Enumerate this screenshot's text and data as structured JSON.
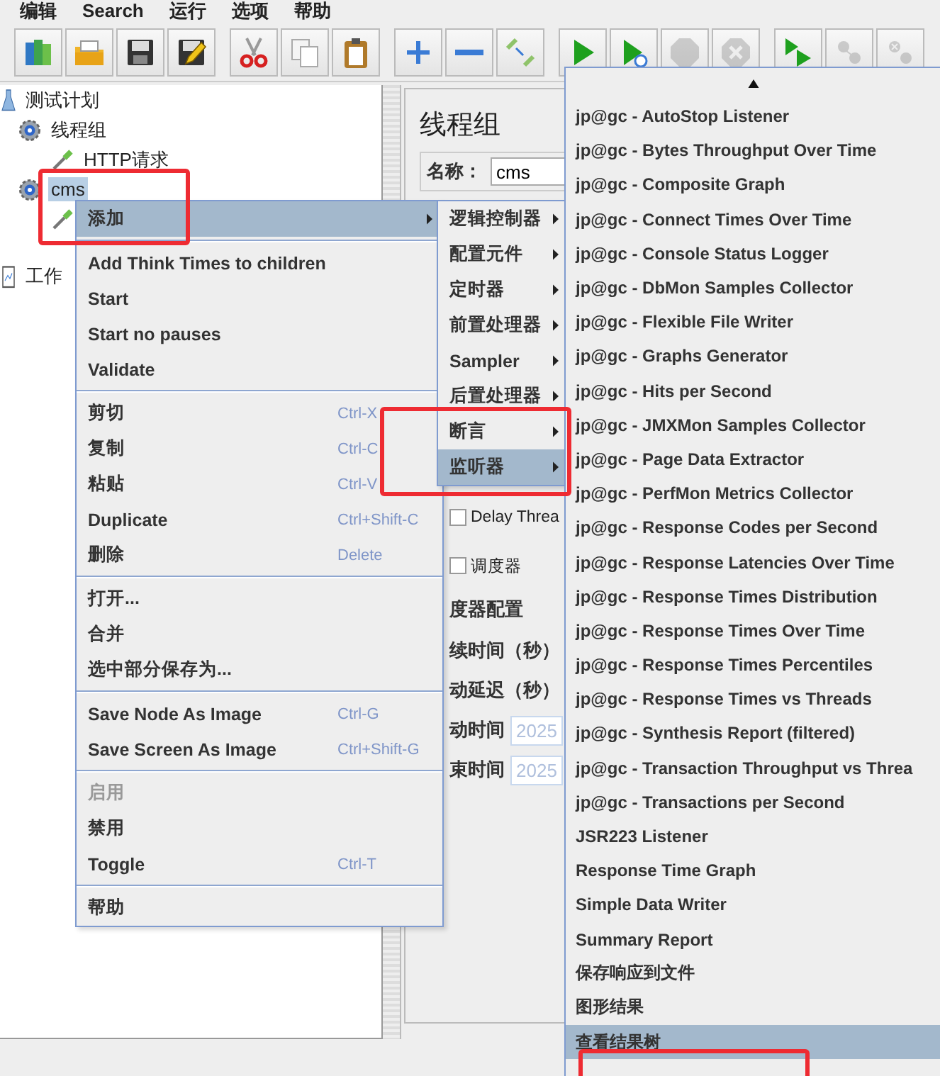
{
  "menubar": [
    "编辑",
    "Search",
    "运行",
    "选项",
    "帮助"
  ],
  "toolbar": [
    {
      "buttons": [
        {
          "kind": "templates",
          "disabled": false
        },
        {
          "kind": "open",
          "disabled": false
        },
        {
          "kind": "save",
          "disabled": false
        },
        {
          "kind": "save-as",
          "disabled": false
        }
      ]
    },
    {
      "buttons": [
        {
          "kind": "cut",
          "disabled": false
        },
        {
          "kind": "copy",
          "disabled": false
        },
        {
          "kind": "paste",
          "disabled": false
        }
      ]
    },
    {
      "buttons": [
        {
          "kind": "expand",
          "disabled": false
        },
        {
          "kind": "collapse",
          "disabled": false
        },
        {
          "kind": "toggle",
          "disabled": false
        }
      ]
    },
    {
      "buttons": [
        {
          "kind": "start",
          "disabled": false
        },
        {
          "kind": "start-no-pause",
          "disabled": false
        },
        {
          "kind": "stop",
          "disabled": true
        },
        {
          "kind": "shutdown",
          "disabled": true
        }
      ]
    },
    {
      "buttons": [
        {
          "kind": "remote-start",
          "disabled": false
        },
        {
          "kind": "remote-stop",
          "disabled": true
        },
        {
          "kind": "remote-shutdown",
          "disabled": true
        }
      ]
    }
  ],
  "tree": [
    {
      "kind": "plan",
      "label": "测试计划",
      "selected": false,
      "children": [
        {
          "kind": "thread-group",
          "label": "线程组",
          "selected": false,
          "children": [
            {
              "kind": "sampler",
              "label": "HTTP请求",
              "selected": false
            }
          ]
        },
        {
          "kind": "thread-group",
          "label": "cms",
          "selected": true,
          "children": [
            {
              "kind": "sampler",
              "selected": false
            }
          ]
        }
      ]
    },
    {
      "kind": "workbench",
      "label": "工作",
      "selected": false
    }
  ],
  "panel": {
    "title": "线程组",
    "name_label": "名称：",
    "name_value": "cms",
    "delay_checkbox": {
      "label": "Delay Threa",
      "checked": false
    },
    "scheduler_checkbox": {
      "label": "调度器",
      "checked": false
    },
    "scheduler_config": {
      "title": "度器配置",
      "fields": [
        {
          "label": "续时间（秒）"
        },
        {
          "label": "动延迟（秒）"
        },
        {
          "label": "动时间",
          "value": "2025"
        },
        {
          "label": "束时间",
          "value": "2025"
        }
      ]
    }
  },
  "context_menu": {
    "groups": [
      {
        "items": [
          {
            "label": "添加",
            "submenu": true,
            "selected": true,
            "disabled": false
          }
        ]
      },
      {
        "items": [
          {
            "label": "Add Think Times to children",
            "submenu": false,
            "selected": false,
            "disabled": false
          },
          {
            "label": "Start",
            "submenu": false,
            "selected": false,
            "disabled": false
          },
          {
            "label": "Start no pauses",
            "submenu": false,
            "selected": false,
            "disabled": false
          },
          {
            "label": "Validate",
            "submenu": false,
            "selected": false,
            "disabled": false
          }
        ]
      },
      {
        "items": [
          {
            "label": "剪切",
            "shortcut": "Ctrl-X",
            "submenu": false,
            "selected": false,
            "disabled": false
          },
          {
            "label": "复制",
            "shortcut": "Ctrl-C",
            "submenu": false,
            "selected": false,
            "disabled": false
          },
          {
            "label": "粘贴",
            "shortcut": "Ctrl-V",
            "submenu": false,
            "selected": false,
            "disabled": false
          },
          {
            "label": "Duplicate",
            "shortcut": "Ctrl+Shift-C",
            "submenu": false,
            "selected": false,
            "disabled": false
          },
          {
            "label": "删除",
            "shortcut": "Delete",
            "submenu": false,
            "selected": false,
            "disabled": false
          }
        ]
      },
      {
        "items": [
          {
            "label": "打开...",
            "submenu": false,
            "selected": false,
            "disabled": false
          },
          {
            "label": "合并",
            "submenu": false,
            "selected": false,
            "disabled": false
          },
          {
            "label": "选中部分保存为...",
            "submenu": false,
            "selected": false,
            "disabled": false
          }
        ]
      },
      {
        "items": [
          {
            "label": "Save Node As Image",
            "shortcut": "Ctrl-G",
            "submenu": false,
            "selected": false,
            "disabled": false
          },
          {
            "label": "Save Screen As Image",
            "shortcut": "Ctrl+Shift-G",
            "submenu": false,
            "selected": false,
            "disabled": false
          }
        ]
      },
      {
        "items": [
          {
            "label": "启用",
            "submenu": false,
            "selected": false,
            "disabled": true
          },
          {
            "label": "禁用",
            "submenu": false,
            "selected": false,
            "disabled": false
          },
          {
            "label": "Toggle",
            "shortcut": "Ctrl-T",
            "submenu": false,
            "selected": false,
            "disabled": false
          }
        ]
      },
      {
        "items": [
          {
            "label": "帮助",
            "submenu": false,
            "selected": false,
            "disabled": false
          }
        ]
      }
    ]
  },
  "category_menu": {
    "items": [
      {
        "label": "逻辑控制器",
        "selected": false
      },
      {
        "label": "配置元件",
        "selected": false
      },
      {
        "label": "定时器",
        "selected": false
      },
      {
        "label": "前置处理器",
        "selected": false
      },
      {
        "label": "Sampler",
        "selected": false
      },
      {
        "label": "后置处理器",
        "selected": false
      },
      {
        "label": "断言",
        "selected": false
      },
      {
        "label": "监听器",
        "selected": true
      }
    ]
  },
  "listener_menu": {
    "items": [
      {
        "label": "jp@gc - AutoStop Listener",
        "selected": false
      },
      {
        "label": "jp@gc - Bytes Throughput Over Time",
        "selected": false
      },
      {
        "label": "jp@gc - Composite Graph",
        "selected": false
      },
      {
        "label": "jp@gc - Connect Times Over Time",
        "selected": false
      },
      {
        "label": "jp@gc - Console Status Logger",
        "selected": false
      },
      {
        "label": "jp@gc - DbMon Samples Collector",
        "selected": false
      },
      {
        "label": "jp@gc - Flexible File Writer",
        "selected": false
      },
      {
        "label": "jp@gc - Graphs Generator",
        "selected": false
      },
      {
        "label": "jp@gc - Hits per Second",
        "selected": false
      },
      {
        "label": "jp@gc - JMXMon Samples Collector",
        "selected": false
      },
      {
        "label": "jp@gc - Page Data Extractor",
        "selected": false
      },
      {
        "label": "jp@gc - PerfMon Metrics Collector",
        "selected": false
      },
      {
        "label": "jp@gc - Response Codes per Second",
        "selected": false
      },
      {
        "label": "jp@gc - Response Latencies Over Time",
        "selected": false
      },
      {
        "label": "jp@gc - Response Times Distribution",
        "selected": false
      },
      {
        "label": "jp@gc - Response Times Over Time",
        "selected": false
      },
      {
        "label": "jp@gc - Response Times Percentiles",
        "selected": false
      },
      {
        "label": "jp@gc - Response Times vs Threads",
        "selected": false
      },
      {
        "label": "jp@gc - Synthesis Report (filtered)",
        "selected": false
      },
      {
        "label": "jp@gc - Transaction Throughput vs Threa",
        "selected": false
      },
      {
        "label": "jp@gc - Transactions per Second",
        "selected": false
      },
      {
        "label": "JSR223 Listener",
        "selected": false
      },
      {
        "label": "Response Time Graph",
        "selected": false
      },
      {
        "label": "Simple Data Writer",
        "selected": false
      },
      {
        "label": "Summary Report",
        "selected": false
      },
      {
        "label": "保存响应到文件",
        "selected": false
      },
      {
        "label": "图形结果",
        "selected": false
      },
      {
        "label": "查看结果树",
        "selected": true
      }
    ]
  },
  "highlight_frames": [
    {
      "kind": "frame"
    },
    {
      "kind": "frame"
    },
    {
      "kind": "frame"
    }
  ]
}
